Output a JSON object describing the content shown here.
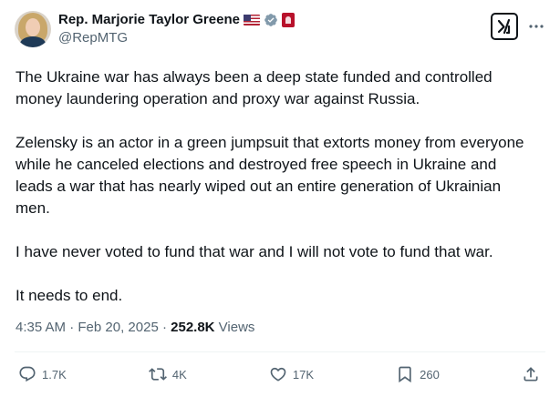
{
  "author": {
    "display_name": "Rep. Marjorie Taylor Greene",
    "handle": "@RepMTG"
  },
  "icons": {
    "flag": "us-flag-icon",
    "verified": "verified-badge-icon",
    "affiliation": "congress-badge-icon",
    "grok": "grok-icon",
    "more": "more-icon",
    "reply": "reply-icon",
    "retweet": "retweet-icon",
    "like": "like-icon",
    "bookmark": "bookmark-icon",
    "share": "share-icon"
  },
  "tweet": {
    "paragraphs": [
      "The Ukraine war has always been a deep state funded and controlled money laundering operation and proxy war against Russia.",
      "Zelensky is an actor in a green jumpsuit that extorts money from everyone while he canceled elections and destroyed free speech in Ukraine and leads a war that has nearly wiped out an entire generation of Ukrainian men.",
      "I have never voted to fund that war and I will not vote to fund that war.",
      "It needs to end."
    ],
    "time": "4:35 AM",
    "separator": " · ",
    "date": "Feb 20, 2025",
    "views_count": "252.8K",
    "views_label": " Views"
  },
  "actions": {
    "replies": "1.7K",
    "retweets": "4K",
    "likes": "17K",
    "bookmarks": "260"
  },
  "colors": {
    "text": "#0f1419",
    "secondary": "#536471",
    "verified_gray": "#829aab",
    "divider": "#eff3f4"
  }
}
